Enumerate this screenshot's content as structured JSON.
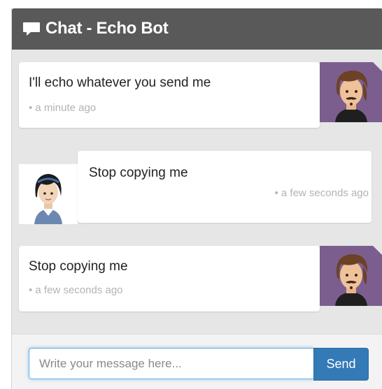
{
  "header": {
    "title": "Chat - Echo Bot",
    "icon": "chat-bubble-icon"
  },
  "messages": [
    {
      "sender": "bot",
      "avatar": "bot-avatar-icon",
      "text": "I'll echo whatever you send me",
      "time": "• a minute ago"
    },
    {
      "sender": "user",
      "avatar": "user-avatar-icon",
      "text": "Stop copying me",
      "time": "• a few seconds ago"
    },
    {
      "sender": "bot",
      "avatar": "bot-avatar-icon",
      "text": "Stop copying me",
      "time": "• a few seconds ago"
    }
  ],
  "composer": {
    "placeholder": "Write your message here...",
    "value": "",
    "send_label": "Send"
  },
  "colors": {
    "header_bg": "#595959",
    "panel_bg": "#e6e6e6",
    "accent": "#337ab7",
    "bot_avatar_bg": "#7b5e8e",
    "time_text": "#b3b3b3"
  }
}
